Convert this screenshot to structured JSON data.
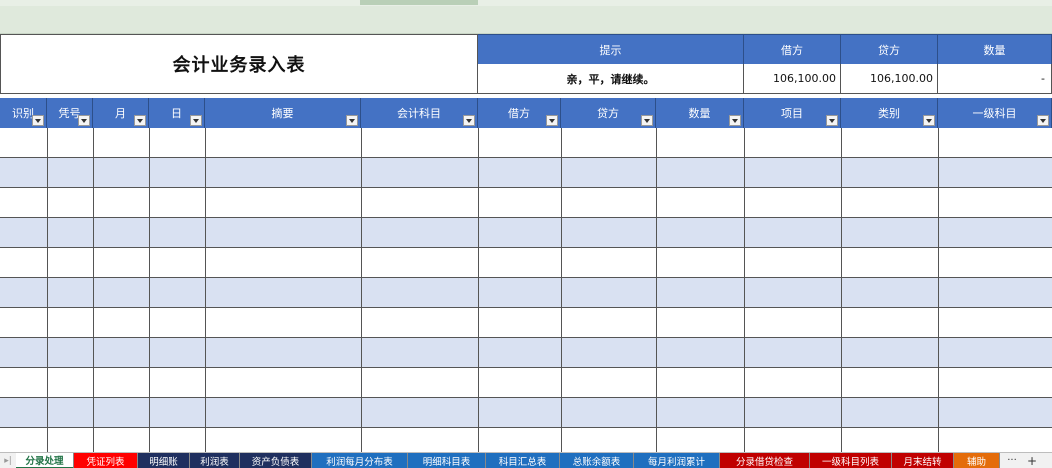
{
  "title": "会计业务录入表",
  "summary_headers": {
    "hint": "提示",
    "debit": "借方",
    "credit": "贷方",
    "quantity": "数量"
  },
  "summary_values": {
    "hint": "亲，平，请继续。",
    "debit": "106,100.00",
    "credit": "106,100.00",
    "quantity": "-"
  },
  "columns": [
    "识别",
    "凭号",
    "月",
    "日",
    "摘要",
    "会计科目",
    "借方",
    "贷方",
    "数量",
    "项目",
    "类别",
    "一级科目"
  ],
  "sheet_tabs": [
    {
      "label": "分录处理",
      "color": "#ffffff",
      "active": true
    },
    {
      "label": "凭证列表",
      "color": "#ff0000"
    },
    {
      "label": "明细账",
      "color": "#1f2f5f"
    },
    {
      "label": "利润表",
      "color": "#1f2f5f"
    },
    {
      "label": "资产负债表",
      "color": "#1f2f5f"
    },
    {
      "label": "利润每月分布表",
      "color": "#1f6fbf"
    },
    {
      "label": "明细科目表",
      "color": "#1f6fbf"
    },
    {
      "label": "科目汇总表",
      "color": "#1f6fbf"
    },
    {
      "label": "总账余额表",
      "color": "#1f6fbf"
    },
    {
      "label": "每月利润累计",
      "color": "#1f6fbf"
    },
    {
      "label": "分录借贷检查",
      "color": "#c00000"
    },
    {
      "label": "一级科目列表",
      "color": "#c00000"
    },
    {
      "label": "月末结转",
      "color": "#c00000"
    },
    {
      "label": "辅助",
      "color": "#e46c0a"
    }
  ],
  "tab_more": "···",
  "tab_add": "+"
}
